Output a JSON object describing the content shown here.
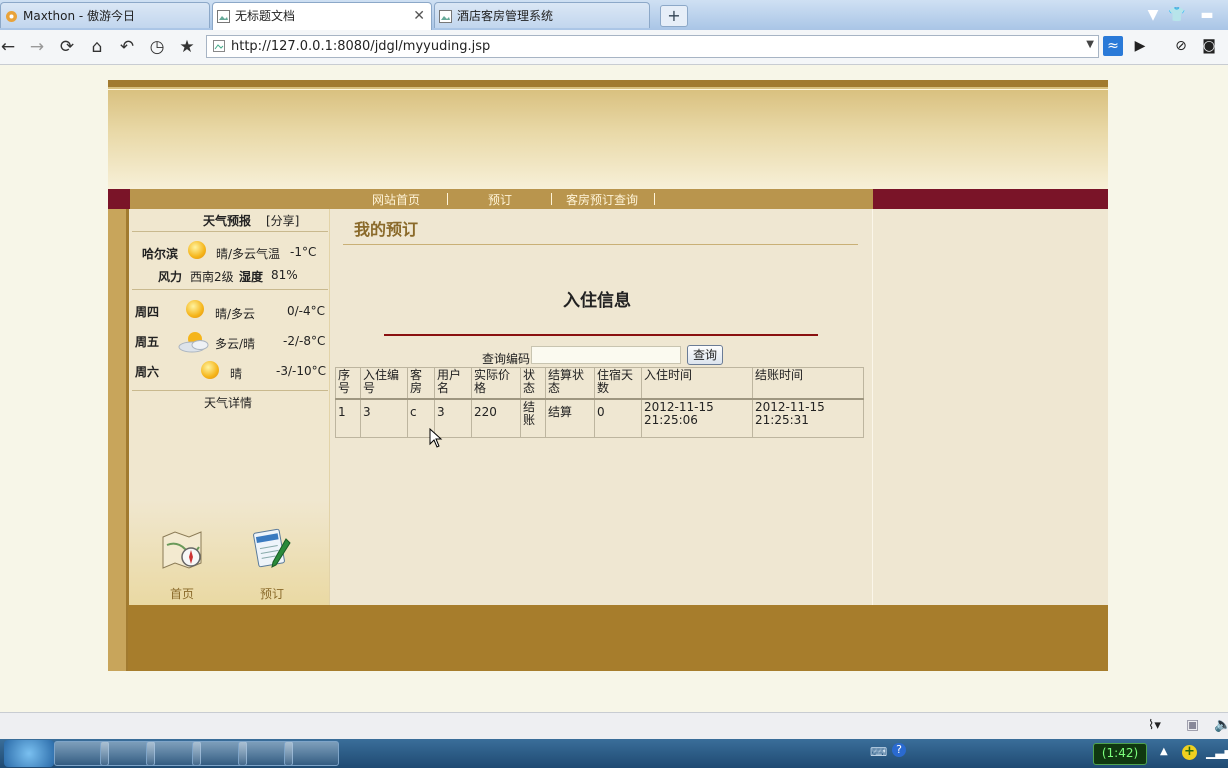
{
  "browser": {
    "tabs": [
      {
        "label": "Maxthon - 傲游今日",
        "active": false
      },
      {
        "label": "无标题文档",
        "active": true
      },
      {
        "label": "酒店客房管理系统",
        "active": false
      }
    ],
    "new_tab": "+",
    "url": "http://127.0.0.1:8080/jdgl/myyuding.jsp"
  },
  "site": {
    "menu": [
      "网站首页",
      "预订",
      "客房预订查询"
    ],
    "menu_sep": "|"
  },
  "weather": {
    "title": "天气预报",
    "share": "[分享]",
    "city": "哈尔滨",
    "today_desc": "晴/多云气温",
    "today_temp": "-1°C",
    "wind_label": "风力",
    "wind_value": "西南2级",
    "humidity_label": "湿度",
    "humidity_value": "81%",
    "days": [
      {
        "day": "周四",
        "desc": "晴/多云",
        "temp": "0/-4°C",
        "icon": "sun-icon"
      },
      {
        "day": "周五",
        "desc": "多云/晴",
        "temp": "-2/-8°C",
        "icon": "cloud-sun-icon"
      },
      {
        "day": "周六",
        "desc": "晴",
        "temp": "-3/-10°C",
        "icon": "sun-icon"
      }
    ],
    "details": "天气详情"
  },
  "bottom_icons": [
    {
      "label": "首页",
      "icon": "map-compass-icon"
    },
    {
      "label": "预订",
      "icon": "notepad-pen-icon"
    }
  ],
  "main": {
    "heading": "我的预订",
    "section_title": "入住信息",
    "query_label": "查询编码",
    "query_value": "",
    "query_button": "查询",
    "table": {
      "headers": [
        "序号",
        "入住编号",
        "客房",
        "用户名",
        "实际价格",
        "状态",
        "结算状态",
        "住宿天数",
        "入住时间",
        "结账时间"
      ],
      "rows": [
        [
          "1",
          "3",
          "c",
          "3",
          "220",
          "结账",
          "结算",
          "0",
          "2012-11-15 21:25:06",
          "2012-11-15 21:25:31"
        ]
      ]
    }
  },
  "taskbar": {
    "clock": "(1:42)"
  },
  "colors": {
    "accent_gold": "#a77d2c",
    "menu_maroon": "#7a1428",
    "heading_brown": "#8a6a2a",
    "divider_red": "#8a1010"
  }
}
